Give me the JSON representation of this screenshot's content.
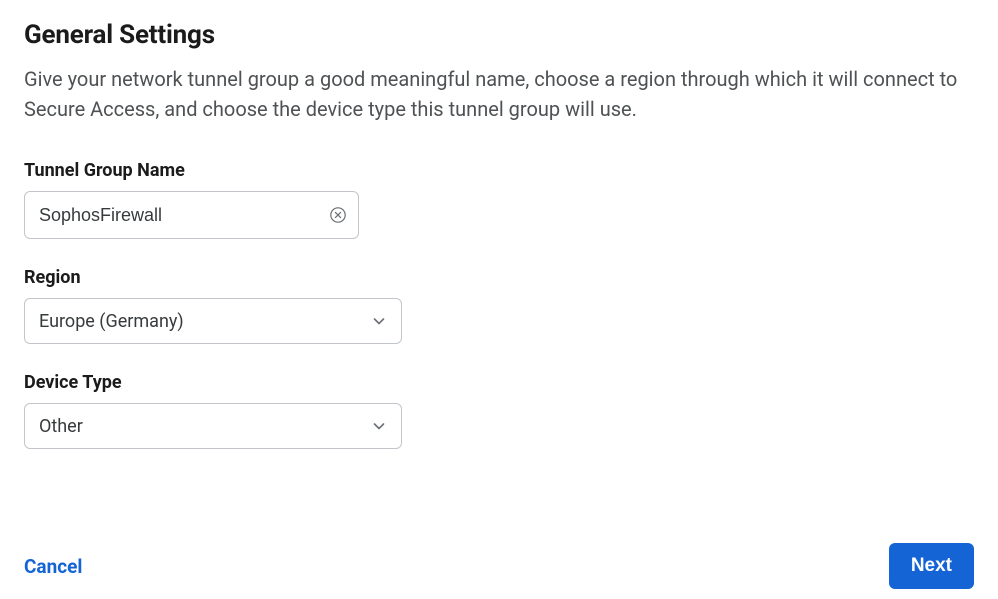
{
  "page": {
    "title": "General Settings",
    "description": "Give your network tunnel group a good meaningful name, choose a region through which it will connect to Secure Access, and choose the device type this tunnel group will use."
  },
  "fields": {
    "tunnel_group_name": {
      "label": "Tunnel Group Name",
      "value": "SophosFirewall"
    },
    "region": {
      "label": "Region",
      "value": "Europe (Germany)"
    },
    "device_type": {
      "label": "Device Type",
      "value": "Other"
    }
  },
  "footer": {
    "cancel_label": "Cancel",
    "next_label": "Next"
  },
  "colors": {
    "accent": "#1464d6",
    "border": "#c2c6cb",
    "text": "#1b1b1b",
    "muted": "#4f5254"
  }
}
